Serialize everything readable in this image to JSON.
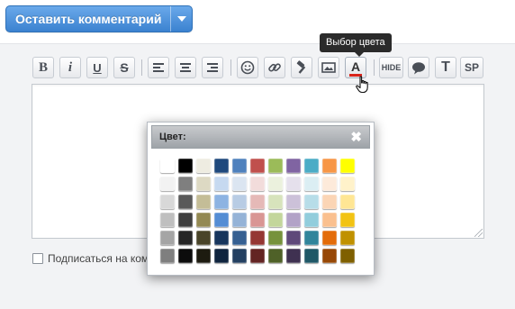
{
  "header": {
    "leave_comment_label": "Оставить комментарий"
  },
  "tooltip": {
    "text": "Выбор цвета"
  },
  "toolbar": {
    "bold": "B",
    "italic": "i",
    "underline": "U",
    "strike": "S",
    "hide": "HIDE",
    "text_size": "T",
    "spoiler": "SP",
    "font_color": "A",
    "icons": [
      "bold-icon",
      "italic-icon",
      "underline-icon",
      "strikethrough-icon",
      "align-left-icon",
      "align-center-icon",
      "align-right-icon",
      "smiley-icon",
      "link-icon",
      "hammer-icon",
      "image-icon",
      "font-color-icon",
      "hide-icon",
      "speech-bubble-icon",
      "text-size-icon",
      "spoiler-icon"
    ]
  },
  "subscribe": {
    "label": "Подписаться на ком"
  },
  "color_popup": {
    "title": "Цвет:",
    "close_symbol": "✖",
    "colors": [
      [
        "#ffffff",
        "#000000",
        "#eeece1",
        "#1f497d",
        "#4f81bd",
        "#c0504d",
        "#9bbb59",
        "#8064a2",
        "#4bacc6",
        "#f79646",
        "#ffff00"
      ],
      [
        "#f2f2f2",
        "#7f7f7f",
        "#ddd9c3",
        "#c6d9f0",
        "#dbe5f1",
        "#f2dcdb",
        "#ebf1dd",
        "#e5e0ec",
        "#dbeef3",
        "#fdeada",
        "#fff2ca"
      ],
      [
        "#d8d8d8",
        "#595959",
        "#c4bd97",
        "#8db3e2",
        "#b8cce4",
        "#e5b9b7",
        "#d7e3bc",
        "#ccc1d9",
        "#b7dde8",
        "#fbd5b5",
        "#ffe694"
      ],
      [
        "#bfbfbf",
        "#3f3f3f",
        "#938953",
        "#548dd4",
        "#95b3d7",
        "#d99694",
        "#c3d69b",
        "#b2a2c7",
        "#92cddc",
        "#fac08f",
        "#f2c314"
      ],
      [
        "#a5a5a5",
        "#262626",
        "#494429",
        "#17365d",
        "#366092",
        "#953734",
        "#76923c",
        "#5f497a",
        "#31859b",
        "#e36c09",
        "#c09100"
      ],
      [
        "#7f7f7f",
        "#0c0c0c",
        "#1d1b10",
        "#0f243e",
        "#244061",
        "#632423",
        "#4f6128",
        "#3f3151",
        "#205867",
        "#974806",
        "#7f6000"
      ]
    ]
  },
  "colors": {
    "primary_button": "#3b82d0",
    "tooltip_bg": "#2b2b2b",
    "font_color_underline": "#d9241b"
  }
}
